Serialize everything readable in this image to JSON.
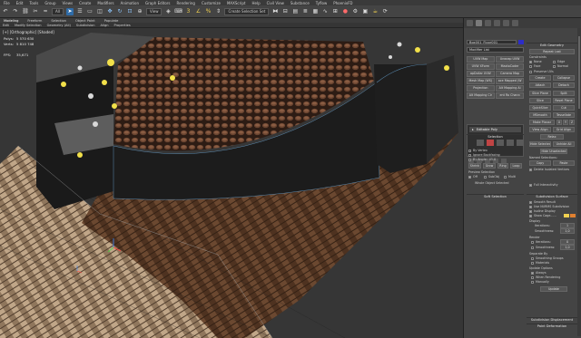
{
  "menubar": [
    "File",
    "Edit",
    "Tools",
    "Group",
    "Views",
    "Create",
    "Modifiers",
    "Animation",
    "Graph Editors",
    "Rendering",
    "Customize",
    "MAXScript",
    "Help",
    "Civil View",
    "Substance",
    "Tyflow",
    "PhoenixFD"
  ],
  "toolbar": {
    "selection_filter": "All",
    "create_selection_set": "Create Selection Set",
    "view_dropdown": "View"
  },
  "ribbon": {
    "tabs": [
      "Modeling",
      "Freeform",
      "Selection",
      "Object Paint",
      "Populate"
    ],
    "active_tab": "Modeling",
    "subtabs": [
      "Edit",
      "Modify Selection",
      "Geometry (All)",
      "Subdivision",
      "Align",
      "Properties"
    ]
  },
  "viewport": {
    "label": "[+] [Orthographic] [Shaded]",
    "stats": {
      "polys_label": "Polys:",
      "polys_value": "5 570 630",
      "verts_label": "Verts:",
      "verts_value": "5 810 748",
      "fps_label": "FPS:",
      "fps_value": "35,671",
      "extra_1": "5 574 ",
      "extra_2": "5 858 "
    }
  },
  "panel": {
    "object_name": "Box001_Floor001",
    "object_color": "#2d2dc8",
    "modifier_list": "Modifier List",
    "modifier_buttons": [
      "UVW Map",
      "Unwrap UVW",
      "UVW XForm",
      "MaxtoCoder",
      "apDollar UVW",
      "Camera Map",
      "Mesh Map (WS)",
      "ace Mapped (W",
      "Projection",
      "Alt Mapping Ai",
      "Alt Mapping Cir",
      "ent Ro Chann"
    ],
    "stack_item": "Editable Poly",
    "selection_head": "Selection",
    "by_vertex": "By Vertex",
    "ignore_backfacing": "Ignore Backfacing",
    "by_angle": "By Angle:",
    "by_angle_value": "45.0",
    "shrink": "Shrink",
    "grow": "Grow",
    "ring": "Ring",
    "loop": "Loop",
    "preview_selection": "Preview Selection",
    "preview_off": "Off",
    "preview_subobj": "SubObj",
    "preview_multi": "Multi",
    "whole_object_selected": "Whole Object Selected",
    "soft_selection": "Soft Selection",
    "edit_geometry": "Edit Geometry",
    "repeat_last": "Repeat Last",
    "constraints": "Constraints",
    "none": "None",
    "edge": "Edge",
    "face": "Face",
    "normal": "Normal",
    "preserve_uvs": "Preserve UVs",
    "create": "Create",
    "collapse": "Collapse",
    "attach": "Attach",
    "detach": "Detach",
    "slice_plane": "Slice Plane",
    "split": "Split",
    "slice": "Slice",
    "reset_plane": "Reset Plane",
    "quickslice": "QuickSlice",
    "cut": "Cut",
    "msmooth": "MSmooth",
    "tessellate": "Tessellate",
    "make_planar": "Make Planar",
    "x": "X",
    "y": "Y",
    "z": "Z",
    "view_align": "View Align",
    "grid_align": "Grid Align",
    "relax": "Relax",
    "hide_selected": "Hide Selected",
    "unhide_all": "Unhide All",
    "hide_unselected": "Hide Unselected",
    "named_selections": "Named Selections:",
    "copy": "Copy",
    "paste": "Paste",
    "delete_isolated": "Delete Isolated Vertices",
    "full_interactivity": "Full Interactivity",
    "subdivision_surface": "Subdivision Surface",
    "smooth_result": "Smooth Result",
    "use_nurms": "Use NURMS Subdivision",
    "isoline_display": "Isoline Display",
    "show_cage": "Show Cage......",
    "display": "Display",
    "iterations": "Iterations:",
    "iterations_value": "1",
    "smoothness": "Smoothness:",
    "smoothness_value": "1,0",
    "render": "Render",
    "render_iterations_value": "0",
    "render_smoothness_value": "1,0",
    "separate_by": "Separate By",
    "smoothing_groups": "Smoothing Groups",
    "materials": "Materials",
    "update_options": "Update Options",
    "always": "Always",
    "when_rendering": "When Rendering",
    "manually": "Manually",
    "update": "Update",
    "subdivision_displacement": "Subdivision Displacement",
    "paint_deformation": "Paint Deformation",
    "cage_color_1": "#f0d050",
    "cage_color_2": "#e08030"
  }
}
